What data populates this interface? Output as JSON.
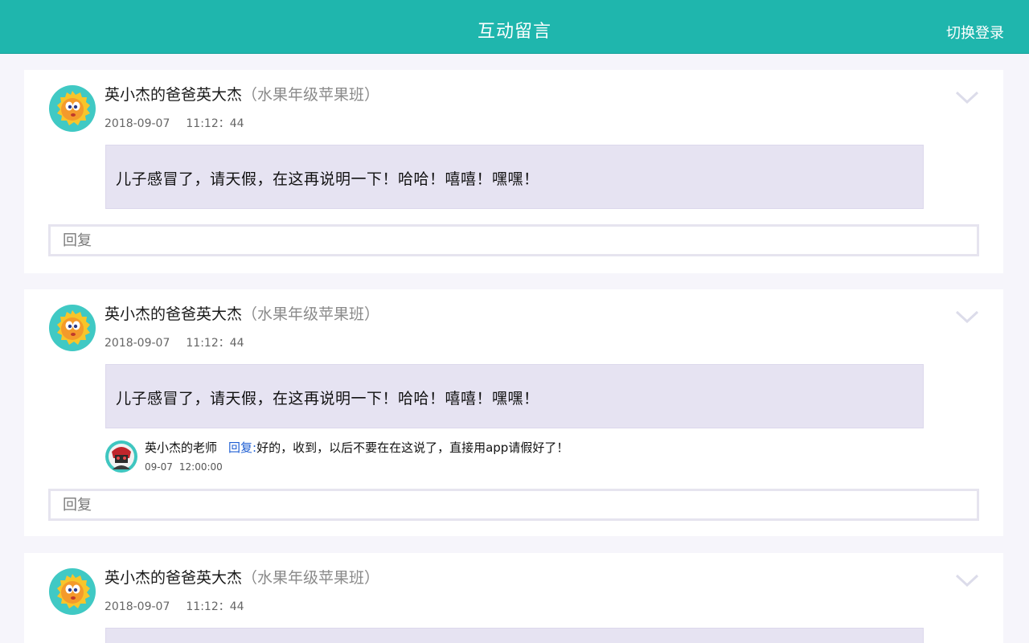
{
  "header": {
    "title": "互动留言",
    "login_label": "切换登录"
  },
  "messages": [
    {
      "author": "英小杰的爸爸英大杰",
      "class_name": "（水果年级苹果班）",
      "date": "2018-09-07",
      "time": "11:12：44",
      "content": "儿子感冒了，请天假，在这再说明一下！哈哈！嘻嘻！嘿嘿！",
      "reply_placeholder": "回复"
    },
    {
      "author": "英小杰的爸爸英大杰",
      "class_name": "（水果年级苹果班）",
      "date": "2018-09-07",
      "time": "11:12：44",
      "content": "儿子感冒了，请天假，在这再说明一下！哈哈！嘻嘻！嘿嘿！",
      "reply": {
        "author": "英小杰的老师",
        "label": "回复:",
        "content": "好的，收到，以后不要在在这说了，直接用app请假好了！",
        "date": "09-07",
        "time": "12:00:00"
      },
      "reply_placeholder": "回复"
    },
    {
      "author": "英小杰的爸爸英大杰",
      "class_name": "（水果年级苹果班）",
      "date": "2018-09-07",
      "time": "11:12：44"
    }
  ],
  "icons": {
    "expand": "chevron-down-icon",
    "avatar": "sun-mascot-avatar-icon",
    "teacher_avatar": "teacher-avatar-icon"
  },
  "colors": {
    "header": "#1fb6ad",
    "message_bg": "#e6e3f2",
    "reply_label": "#1f5fd3"
  }
}
